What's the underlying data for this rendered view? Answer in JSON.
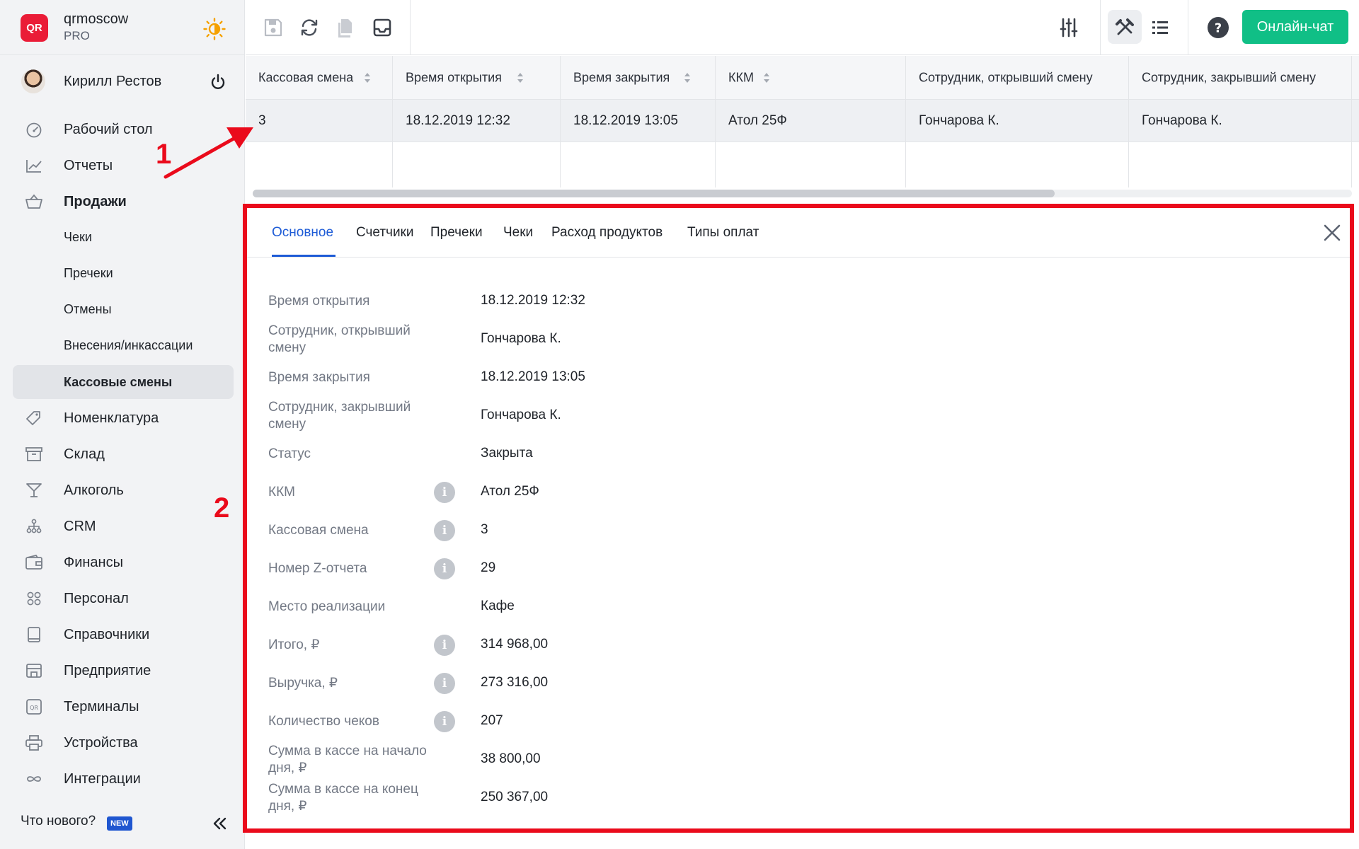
{
  "brand": {
    "logo_text": "QR",
    "name": "qrmoscow",
    "plan": "PRO"
  },
  "user": {
    "name": "Кирилл Рестов"
  },
  "nav": {
    "items": [
      {
        "label": "Рабочий стол",
        "icon": "dashboard-icon"
      },
      {
        "label": "Отчеты",
        "icon": "reports-chart-icon"
      },
      {
        "label": "Продажи",
        "icon": "basket-icon"
      },
      {
        "label": "Номенклатура",
        "icon": "tag-icon"
      },
      {
        "label": "Склад",
        "icon": "archive-box-icon"
      },
      {
        "label": "Алкоголь",
        "icon": "cocktail-glass-icon"
      },
      {
        "label": "CRM",
        "icon": "hierarchy-icon"
      },
      {
        "label": "Финансы",
        "icon": "wallet-icon"
      },
      {
        "label": "Персонал",
        "icon": "people-icon"
      },
      {
        "label": "Справочники",
        "icon": "book-icon"
      },
      {
        "label": "Предприятие",
        "icon": "store-icon"
      },
      {
        "label": "Терминалы",
        "icon": "qr-terminal-icon"
      },
      {
        "label": "Устройства",
        "icon": "printer-icon"
      },
      {
        "label": "Интеграции",
        "icon": "infinity-icon"
      }
    ],
    "sales_sub": [
      "Чеки",
      "Пречеки",
      "Отмены",
      "Внесения/инкассации",
      "Кассовые смены"
    ]
  },
  "footer": {
    "whats_new": "Что нового?",
    "badge": "NEW"
  },
  "toolbar": {
    "chat_label": "Онлайн-чат"
  },
  "table": {
    "headers": [
      "Кассовая смена",
      "Время открытия",
      "Время закрытия",
      "ККМ",
      "Сотрудник, открывший смену",
      "Сотрудник, закрывший смену"
    ],
    "rows": [
      [
        "3",
        "18.12.2019 12:32",
        "18.12.2019 13:05",
        "Атол 25Ф",
        "Гончарова К.",
        "Гончарова К."
      ]
    ]
  },
  "detail": {
    "tabs": [
      "Основное",
      "Счетчики",
      "Пречеки",
      "Чеки",
      "Расход продуктов",
      "Типы оплат"
    ],
    "fields": [
      {
        "label": "Время открытия",
        "value": "18.12.2019 12:32"
      },
      {
        "label": "Сотрудник, открывший смену",
        "value": "Гончарова К."
      },
      {
        "label": "Время закрытия",
        "value": "18.12.2019 13:05"
      },
      {
        "label": "Сотрудник, закрывший смену",
        "value": "Гончарова К."
      },
      {
        "label": "Статус",
        "value": "Закрыта"
      },
      {
        "label": "ККМ",
        "value": "Атол 25Ф"
      },
      {
        "label": "Кассовая смена",
        "value": "3"
      },
      {
        "label": "Номер Z-отчета",
        "value": "29"
      },
      {
        "label": "Место реализации",
        "value": "Кафе"
      },
      {
        "label": "Итого, ₽",
        "value": "314 968,00"
      },
      {
        "label": "Выручка, ₽",
        "value": "273 316,00"
      },
      {
        "label": "Количество чеков",
        "value": "207"
      },
      {
        "label": "Сумма в кассе на начало дня, ₽",
        "value": "38 800,00"
      },
      {
        "label": "Сумма в кассе на конец дня, ₽",
        "value": "250 367,00"
      }
    ],
    "info_icon_glyph": "i"
  },
  "annotations": [
    "1",
    "2"
  ],
  "colors": {
    "accent": "#1d5bd6",
    "chat": "#10bf86",
    "brand": "#ea1c37",
    "annotation": "#ea0a1b"
  }
}
